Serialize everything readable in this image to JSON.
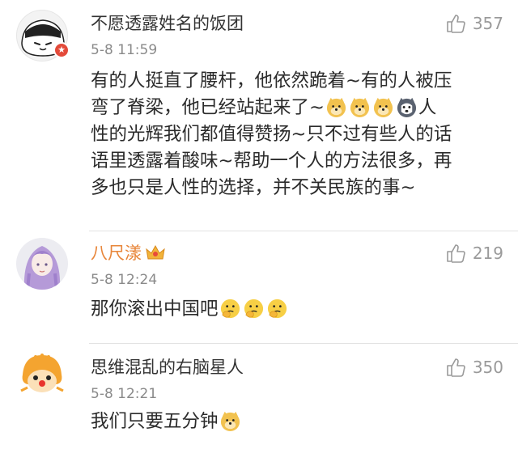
{
  "comments": [
    {
      "username": "不愿透露姓名的饭团",
      "time": "5-8 11:59",
      "likes": "357",
      "text_lines": [
        "有的人挺直了腰杆，他依然跪着~有的人被压",
        "弯了脊梁，他已经站起来了~",
        "性的光辉我们都值得赞扬~只不过有些人的话",
        "语里透露着酸味~帮助一个人的方法很多，再",
        "多也只是人性的选择，并不关民族的事~"
      ],
      "line2_tail": "人",
      "emojis": [
        "doge-emoji",
        "doge-emoji",
        "doge-emoji",
        "husky-emoji"
      ]
    },
    {
      "username": "八尺漾",
      "time": "5-8 12:24",
      "likes": "219",
      "text": "那你滚出中国吧",
      "emojis": [
        "thinking-emoji",
        "thinking-emoji",
        "thinking-emoji"
      ]
    },
    {
      "username": "思维混乱的右脑星人",
      "time": "5-8 12:21",
      "likes": "350",
      "text": "我们只要五分钟",
      "emojis": [
        "doge-emoji"
      ]
    }
  ],
  "colors": {
    "username_orange": "#e8863a",
    "username_default": "#333333",
    "timestamp": "#8a8a8a",
    "like_gray": "#9a9a9a"
  }
}
